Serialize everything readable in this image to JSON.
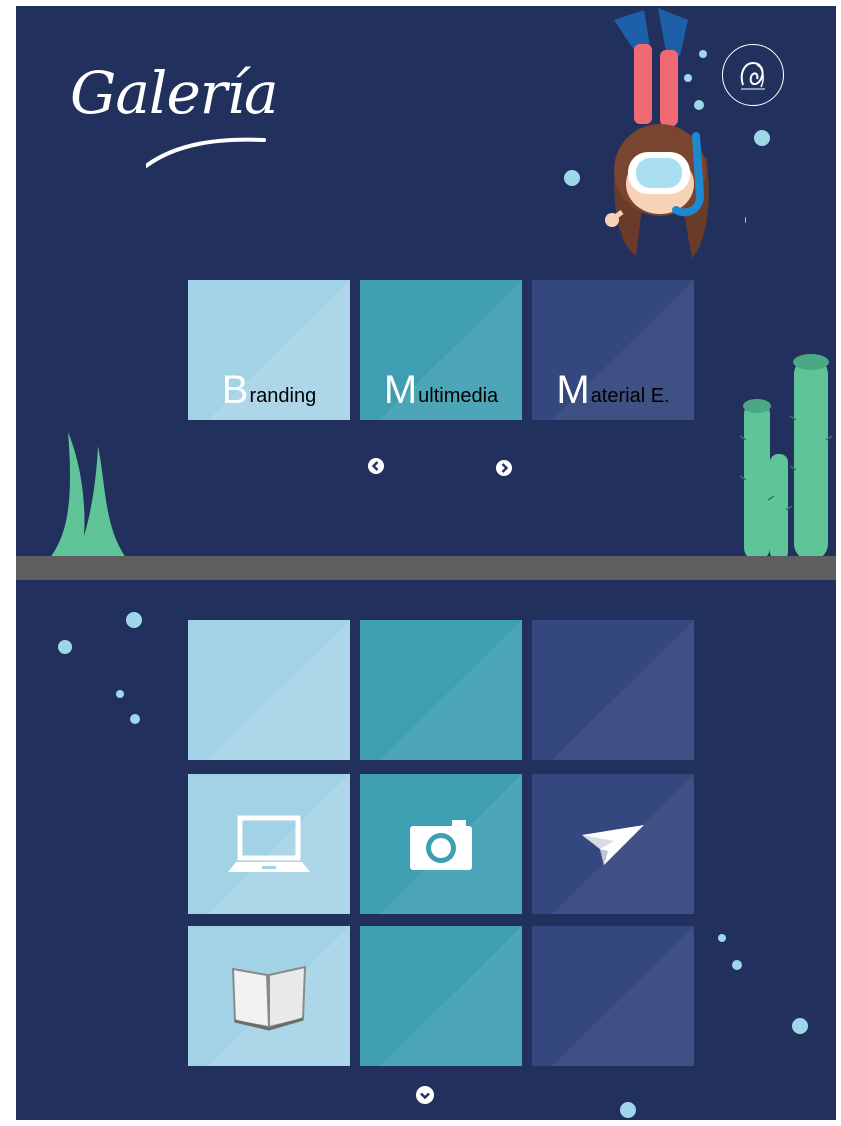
{
  "header": {
    "title": "Galería",
    "logo_icon": "logo-badge-icon"
  },
  "categories": [
    {
      "initial": "B",
      "rest": "randing",
      "color": "#a2d2e5"
    },
    {
      "initial": "M",
      "rest": "ultimedia",
      "color": "#3e9fb2"
    },
    {
      "initial": "M",
      "rest": "aterial E.",
      "color": "#34477e"
    }
  ],
  "carousel": {
    "prev_icon": "chevron-left-icon",
    "next_icon": "chevron-right-icon"
  },
  "grid": {
    "columns": [
      "#a2d2e5",
      "#3e9fb2",
      "#34477e"
    ],
    "icons": [
      "",
      "",
      "",
      "laptop-icon",
      "camera-icon",
      "paper-plane-icon",
      "book-icon",
      "",
      ""
    ]
  },
  "footer": {
    "scroll_down_icon": "chevron-down-icon"
  },
  "colors": {
    "background": "#22305e",
    "ground": "#5d5e60",
    "plant": "#5fc498",
    "bubble": "#9fd7ea"
  }
}
